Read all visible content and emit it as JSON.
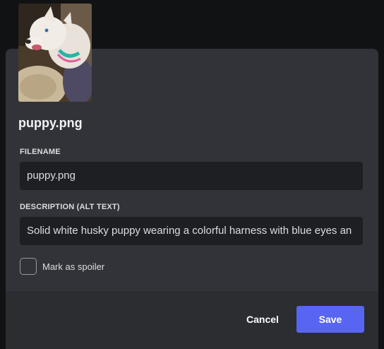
{
  "attachment": {
    "image_alt": "Solid white husky puppy wearing a colorful harness with blue eyes an",
    "title": "puppy.png"
  },
  "fields": {
    "filename_label": "FILENAME",
    "filename_value": "puppy.png",
    "description_label": "DESCRIPTION (ALT TEXT)",
    "description_value": "Solid white husky puppy wearing a colorful harness with blue eyes an"
  },
  "spoiler": {
    "label": "Mark as spoiler",
    "checked": false
  },
  "actions": {
    "cancel_label": "Cancel",
    "save_label": "Save"
  },
  "colors": {
    "modal_bg": "#313338",
    "footer_bg": "#2b2d31",
    "input_bg": "#1e1f22",
    "accent": "#5865f2"
  }
}
